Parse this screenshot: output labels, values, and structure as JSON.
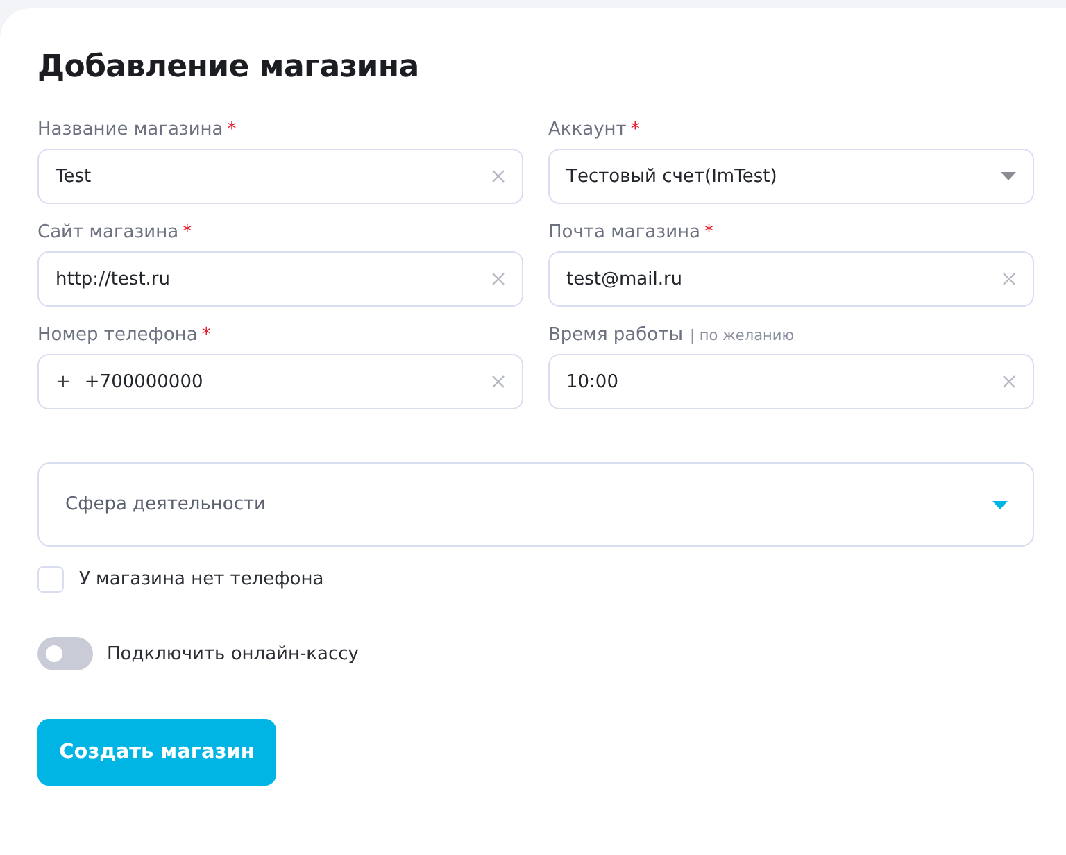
{
  "title": "Добавление магазина",
  "fields": [
    {
      "label": "Название магазина",
      "mark": "*",
      "kind": "text",
      "value": "Test"
    },
    {
      "label": "Аккаунт",
      "mark": "*",
      "kind": "select",
      "value": "Тестовый счет(ImTest)"
    },
    {
      "label": "Сайт магазина",
      "mark": "*",
      "kind": "text",
      "value": "http://test.ru"
    },
    {
      "label": "Почта магазина",
      "mark": "*",
      "kind": "text",
      "value": "test@mail.ru"
    },
    {
      "label": "Номер телефона",
      "mark": "*",
      "kind": "text",
      "prefix": "+",
      "value": "+700000000"
    },
    {
      "label": "Время работы",
      "hint": "| по желанию",
      "kind": "text",
      "value": "10:00"
    }
  ],
  "activity": {
    "placeholder": "Сфера деятельности"
  },
  "no_phone": {
    "label": "У магазина нет телефона",
    "checked": false
  },
  "online_cashbox": {
    "label": "Подключить онлайн-кассу",
    "on": false
  },
  "submit": "Создать магазин"
}
